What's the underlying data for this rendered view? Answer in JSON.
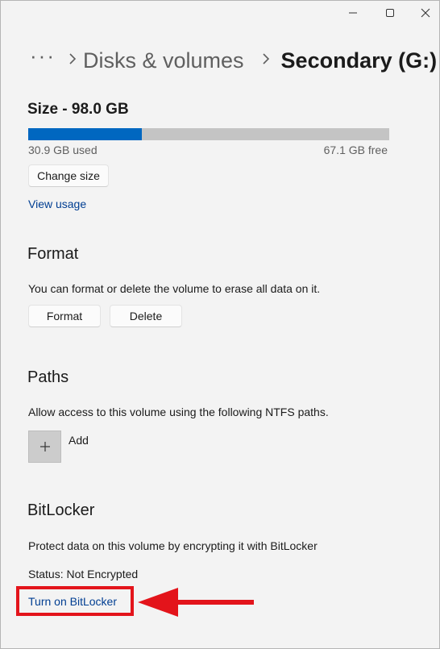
{
  "window": {
    "minimize_icon": "minimize-icon",
    "maximize_icon": "maximize-icon",
    "close_icon": "close-icon"
  },
  "breadcrumb": {
    "more": "···",
    "parent": "Disks & volumes",
    "current": "Secondary (G:)"
  },
  "size": {
    "title": "Size - 98.0 GB",
    "used_label": "30.9 GB used",
    "free_label": "67.1 GB free",
    "used_fraction": 0.315,
    "change_size_label": "Change size",
    "view_usage_label": "View usage"
  },
  "format": {
    "title": "Format",
    "description": "You can format or delete the volume to erase all data on it.",
    "format_label": "Format",
    "delete_label": "Delete"
  },
  "paths": {
    "title": "Paths",
    "description": "Allow access to this volume using the following NTFS paths.",
    "add_label": "Add"
  },
  "bitlocker": {
    "title": "BitLocker",
    "description": "Protect data on this volume by encrypting it with BitLocker",
    "status": "Status: Not Encrypted",
    "turn_on_label": "Turn on BitLocker"
  },
  "colors": {
    "accent": "#0067c0",
    "link": "#003e92",
    "annotation": "#e3141b"
  }
}
